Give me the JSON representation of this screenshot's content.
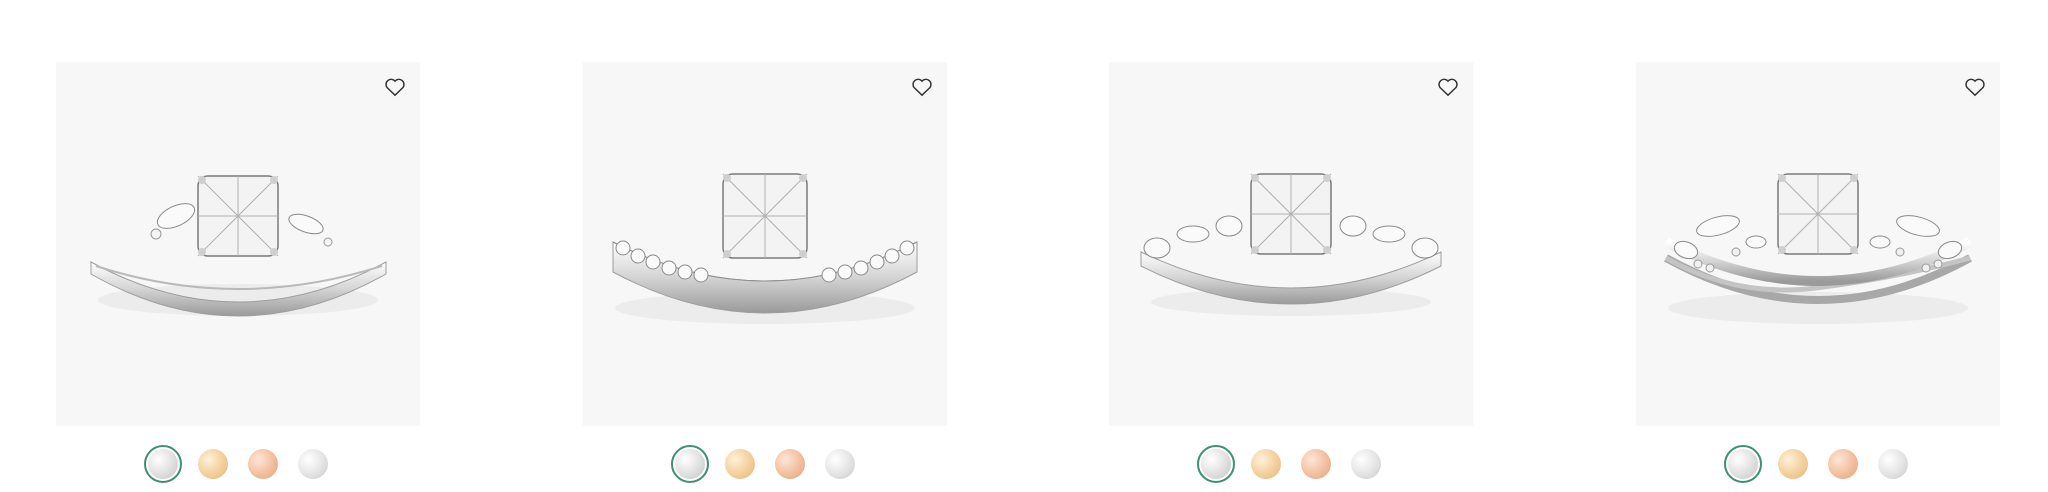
{
  "products": [
    {
      "name_hidden": "",
      "wishlist_icon": "heart-outline-icon",
      "metals": [
        {
          "name": "white-gold",
          "color": "#dcdcdc",
          "selected": true
        },
        {
          "name": "yellow-gold",
          "color": "#f2cd9a",
          "selected": false
        },
        {
          "name": "rose-gold",
          "color": "#efbc9c",
          "selected": false
        },
        {
          "name": "platinum",
          "color": "#e2e2e2",
          "selected": false
        }
      ]
    },
    {
      "wishlist_icon": "heart-outline-icon",
      "metals": [
        {
          "name": "white-gold",
          "color": "#dcdcdc",
          "selected": true
        },
        {
          "name": "yellow-gold",
          "color": "#f2cd9a",
          "selected": false
        },
        {
          "name": "rose-gold",
          "color": "#efbc9c",
          "selected": false
        },
        {
          "name": "platinum",
          "color": "#e2e2e2",
          "selected": false
        }
      ]
    },
    {
      "wishlist_icon": "heart-outline-icon",
      "metals": [
        {
          "name": "white-gold",
          "color": "#dcdcdc",
          "selected": true
        },
        {
          "name": "yellow-gold",
          "color": "#f2cd9a",
          "selected": false
        },
        {
          "name": "rose-gold",
          "color": "#efbc9c",
          "selected": false
        },
        {
          "name": "platinum",
          "color": "#e2e2e2",
          "selected": false
        }
      ]
    },
    {
      "wishlist_icon": "heart-outline-icon",
      "metals": [
        {
          "name": "white-gold",
          "color": "#dcdcdc",
          "selected": true
        },
        {
          "name": "yellow-gold",
          "color": "#f2cd9a",
          "selected": false
        },
        {
          "name": "rose-gold",
          "color": "#efbc9c",
          "selected": false
        },
        {
          "name": "platinum",
          "color": "#e2e2e2",
          "selected": false
        }
      ]
    }
  ],
  "colors": {
    "selected_ring": "#3f8f78",
    "card_background": "#f7f7f7"
  }
}
